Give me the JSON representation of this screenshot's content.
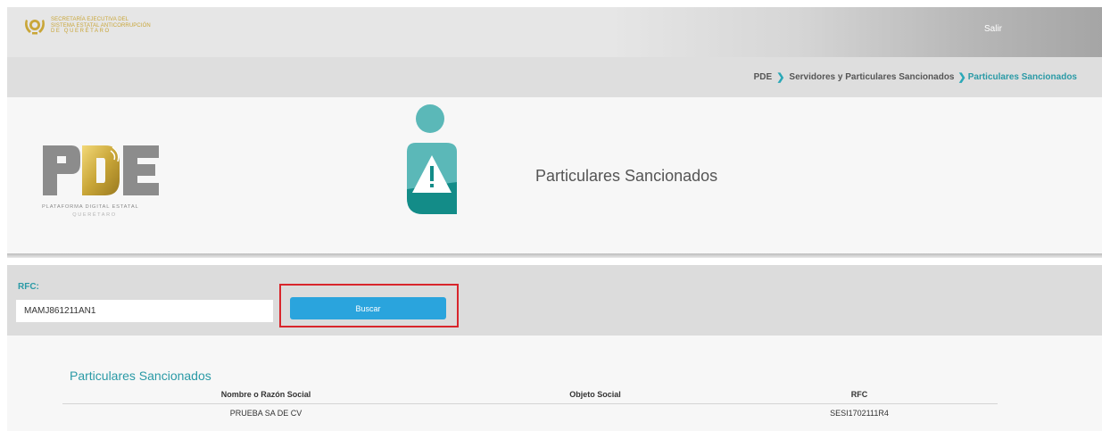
{
  "header": {
    "logo_lines": [
      "SECRETARÍA EJECUTIVA DEL",
      "SISTEMA ESTATAL ANTICORRUPCIÓN",
      "DE QUERÉTARO"
    ],
    "logout_label": "Salir"
  },
  "breadcrumb": {
    "items": [
      "PDE",
      "Servidores y Particulares Sancionados",
      "Particulares Sancionados"
    ]
  },
  "hero": {
    "logo_word": "PDE",
    "logo_tagline": "PLATAFORMA DIGITAL ESTATAL",
    "logo_state": "QUERÉTARO",
    "title": "Particulares Sancionados"
  },
  "search": {
    "label": "RFC:",
    "value": "MAMJ861211AN1",
    "button_label": "Buscar"
  },
  "results": {
    "title": "Particulares Sancionados",
    "columns": [
      "Nombre o Razón Social",
      "Objeto Social",
      "RFC"
    ],
    "rows": [
      [
        "PRUEBA SA DE CV",
        "",
        "SESI1702111R4"
      ]
    ]
  },
  "colors": {
    "accent_teal": "#2a9aa6",
    "button_blue": "#2aa4dd",
    "highlight_red": "#d8262c",
    "logo_gold": "#c9a638"
  }
}
